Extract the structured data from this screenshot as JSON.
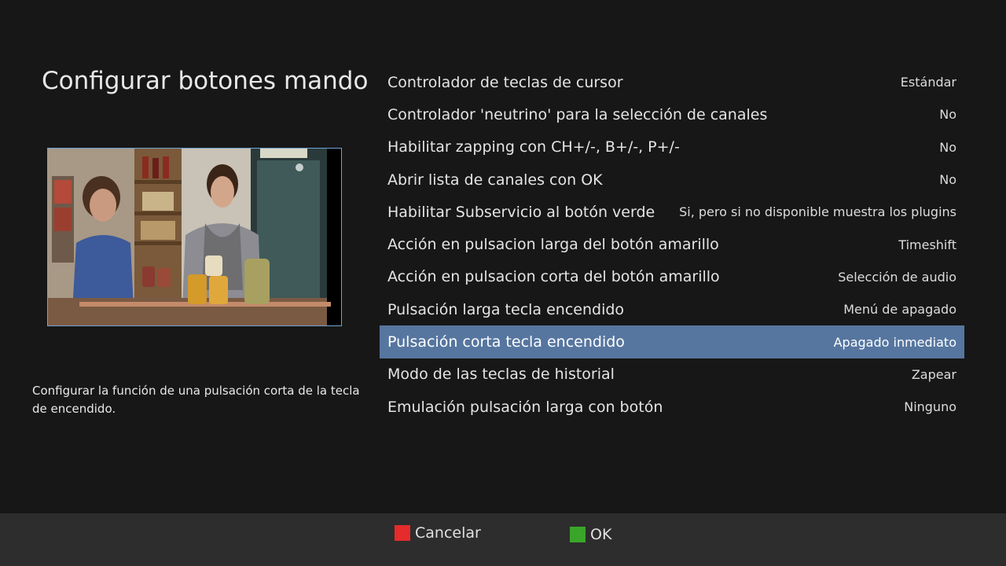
{
  "title": "Configurar botones mando",
  "help_text": "Configurar la función de una pulsación corta de la tecla de encendido.",
  "menu": [
    {
      "label": "Controlador de teclas de cursor",
      "value": "Estándar"
    },
    {
      "label": "Controlador 'neutrino' para la selección de canales",
      "value": "No"
    },
    {
      "label": "Habilitar zapping con CH+/-, B+/-, P+/-",
      "value": "No"
    },
    {
      "label": "Abrir lista de canales con OK",
      "value": "No"
    },
    {
      "label": "Habilitar Subservicio al botón verde",
      "value": "Si, pero si no disponible muestra los plugins"
    },
    {
      "label": "Acción en pulsacion larga del botón amarillo",
      "value": "Timeshift"
    },
    {
      "label": "Acción en pulsacion corta del botón amarillo",
      "value": "Selección de audio"
    },
    {
      "label": "Pulsación larga tecla encendido",
      "value": "Menú de apagado"
    },
    {
      "label": "Pulsación corta tecla encendido",
      "value": "Apagado inmediato",
      "selected": true
    },
    {
      "label": "Modo de las teclas de historial",
      "value": "Zapear"
    },
    {
      "label": "Emulación pulsación larga con botón",
      "value": "Ninguno"
    }
  ],
  "footer": {
    "cancel": {
      "label": "Cancelar",
      "color": "#e52b2b"
    },
    "ok": {
      "label": "OK",
      "color": "#3aa52a"
    }
  },
  "colors": {
    "background": "#171717",
    "selection": "#5676a0",
    "preview_border": "#6fa4d6",
    "footer": "#2d2d2d"
  }
}
